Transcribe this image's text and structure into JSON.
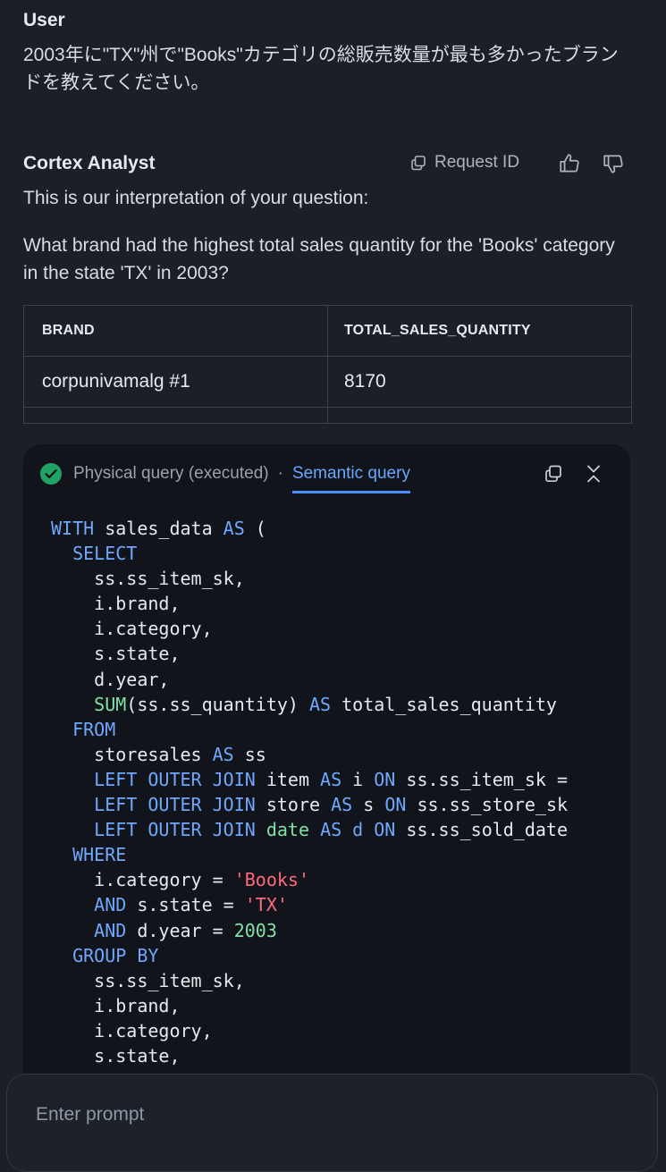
{
  "user": {
    "label": "User",
    "message": "2003年に\"TX\"州で\"Books\"カテゴリの総販売数量が最も多かったブランドを教えてください。"
  },
  "analyst": {
    "name": "Cortex Analyst",
    "request_id_label": "Request ID",
    "interpretation_intro": "This is our interpretation of your question:",
    "question": "What brand had the highest total sales quantity for the 'Books' category in the state 'TX' in 2003?"
  },
  "table": {
    "headers": [
      "BRAND",
      "TOTAL_SALES_QUANTITY"
    ],
    "rows": [
      [
        "corpunivamalg #1",
        "8170"
      ]
    ]
  },
  "query": {
    "tab_physical": "Physical query (executed)",
    "separator": "·",
    "tab_semantic": "Semantic query",
    "active_tab": "Semantic query",
    "code_lines": [
      [
        [
          "kw",
          "WITH"
        ],
        [
          "t",
          " sales_data "
        ],
        [
          "kw",
          "AS"
        ],
        [
          "t",
          " ("
        ]
      ],
      [
        [
          "t",
          "  "
        ],
        [
          "kw",
          "SELECT"
        ]
      ],
      [
        [
          "t",
          "    ss.ss_item_sk,"
        ]
      ],
      [
        [
          "t",
          "    i.brand,"
        ]
      ],
      [
        [
          "t",
          "    i.category,"
        ]
      ],
      [
        [
          "t",
          "    s.state,"
        ]
      ],
      [
        [
          "t",
          "    d.year,"
        ]
      ],
      [
        [
          "t",
          "    "
        ],
        [
          "fn",
          "SUM"
        ],
        [
          "t",
          "(ss.ss_quantity) "
        ],
        [
          "kw",
          "AS"
        ],
        [
          "t",
          " total_sales_quantity"
        ]
      ],
      [
        [
          "t",
          "  "
        ],
        [
          "kw",
          "FROM"
        ]
      ],
      [
        [
          "t",
          "    storesales "
        ],
        [
          "kw",
          "AS"
        ],
        [
          "t",
          " ss"
        ]
      ],
      [
        [
          "t",
          "    "
        ],
        [
          "kw",
          "LEFT OUTER JOIN"
        ],
        [
          "t",
          " item "
        ],
        [
          "kw",
          "AS"
        ],
        [
          "t",
          " i "
        ],
        [
          "kw",
          "ON"
        ],
        [
          "t",
          " ss.ss_item_sk ="
        ]
      ],
      [
        [
          "t",
          "    "
        ],
        [
          "kw",
          "LEFT OUTER JOIN"
        ],
        [
          "t",
          " store "
        ],
        [
          "kw",
          "AS"
        ],
        [
          "t",
          " s "
        ],
        [
          "kw",
          "ON"
        ],
        [
          "t",
          " ss.ss_store_sk"
        ]
      ],
      [
        [
          "t",
          "    "
        ],
        [
          "kw",
          "LEFT OUTER JOIN"
        ],
        [
          "t",
          " "
        ],
        [
          "fn",
          "date"
        ],
        [
          "t",
          " "
        ],
        [
          "kw",
          "AS d ON"
        ],
        [
          "t",
          " ss.ss_sold_date"
        ]
      ],
      [
        [
          "t",
          "  "
        ],
        [
          "kw",
          "WHERE"
        ]
      ],
      [
        [
          "t",
          "    i.category = "
        ],
        [
          "str",
          "'Books'"
        ]
      ],
      [
        [
          "t",
          "    "
        ],
        [
          "kw",
          "AND"
        ],
        [
          "t",
          " s.state = "
        ],
        [
          "str",
          "'TX'"
        ]
      ],
      [
        [
          "t",
          "    "
        ],
        [
          "kw",
          "AND"
        ],
        [
          "t",
          " d.year = "
        ],
        [
          "num",
          "2003"
        ]
      ],
      [
        [
          "t",
          "  "
        ],
        [
          "kw",
          "GROUP BY"
        ]
      ],
      [
        [
          "t",
          "    ss.ss_item_sk,"
        ]
      ],
      [
        [
          "t",
          "    i.brand,"
        ]
      ],
      [
        [
          "t",
          "    i.category,"
        ]
      ],
      [
        [
          "t",
          "    s.state,"
        ]
      ]
    ]
  },
  "prompt": {
    "placeholder": "Enter prompt"
  },
  "icons": {
    "request_id": "copy-icon",
    "thumbs_up": "thumbs-up-icon",
    "thumbs_down": "thumbs-down-icon",
    "executed": "check-circle-icon",
    "copy": "copy-icon",
    "collapse": "collapse-icon"
  },
  "colors": {
    "background": "#1b1f26",
    "code_background": "#11141a",
    "accent": "#4c8dff",
    "success": "#21a366",
    "keyword": "#6ea8ff",
    "function": "#7fe3a6",
    "string": "#ff6b7d"
  }
}
